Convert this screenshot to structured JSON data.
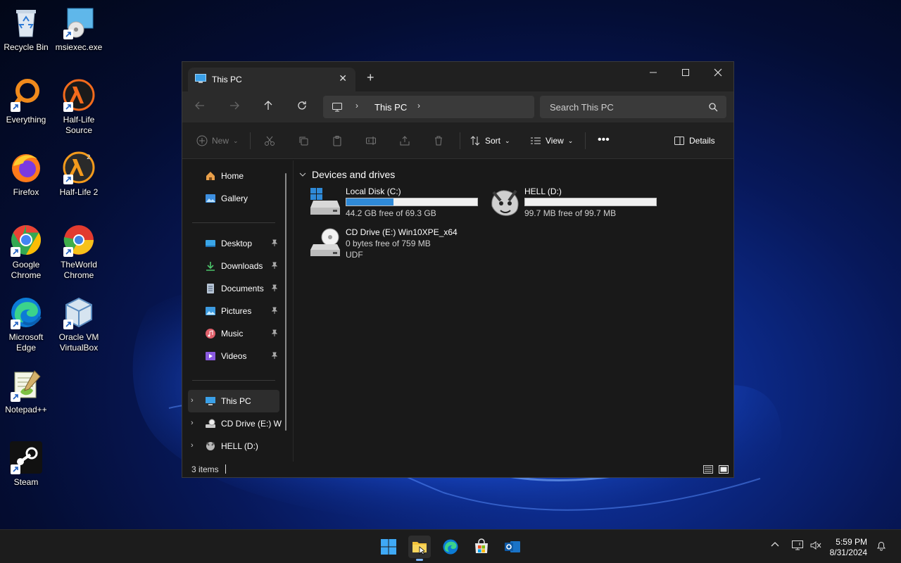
{
  "desktop": {
    "icons": [
      {
        "label": "Recycle Bin",
        "icon": "recycle-bin-icon"
      },
      {
        "label": "msiexec.exe",
        "icon": "installer-icon"
      },
      {
        "label": "Everything",
        "icon": "everything-search-icon"
      },
      {
        "label": "Half-Life Source",
        "icon": "half-life-source-icon"
      },
      {
        "label": "Firefox",
        "icon": "firefox-icon"
      },
      {
        "label": "Half-Life 2",
        "icon": "half-life-2-icon"
      },
      {
        "label": "Google Chrome",
        "icon": "chrome-icon"
      },
      {
        "label": "TheWorld Chrome",
        "icon": "theworld-chrome-icon"
      },
      {
        "label": "Microsoft Edge",
        "icon": "edge-icon"
      },
      {
        "label": "Oracle VM VirtualBox",
        "icon": "virtualbox-icon"
      },
      {
        "label": "Notepad++",
        "icon": "notepad-plus-plus-icon"
      },
      {
        "label": "Steam",
        "icon": "steam-icon"
      }
    ]
  },
  "window": {
    "tab_label": "This PC",
    "address": "This PC",
    "search_placeholder": "Search This PC",
    "toolbar": {
      "new_label": "New",
      "sort_label": "Sort",
      "view_label": "View",
      "details_label": "Details"
    },
    "sidebar": {
      "home": "Home",
      "gallery": "Gallery",
      "quick": [
        {
          "label": "Desktop",
          "icon": "desktop-folder-icon"
        },
        {
          "label": "Downloads",
          "icon": "downloads-icon"
        },
        {
          "label": "Documents",
          "icon": "documents-icon"
        },
        {
          "label": "Pictures",
          "icon": "pictures-icon"
        },
        {
          "label": "Music",
          "icon": "music-icon"
        },
        {
          "label": "Videos",
          "icon": "videos-icon"
        }
      ],
      "tree": [
        {
          "label": "This PC",
          "selected": true
        },
        {
          "label": "CD Drive (E:) Wi"
        },
        {
          "label": "HELL (D:)"
        }
      ]
    },
    "group_title": "Devices and drives",
    "drives": [
      {
        "name": "Local Disk (C:)",
        "info": "44.2 GB free of 69.3 GB",
        "used_fraction": 0.362
      },
      {
        "name": "HELL (D:)",
        "info": "99.7 MB free of 99.7 MB",
        "used_fraction": 0.0
      },
      {
        "name": "CD Drive (E:) Win10XPE_x64",
        "info": "0 bytes free of 759 MB",
        "info2": "UDF"
      }
    ],
    "status_count": "3 items"
  },
  "taskbar": {
    "time": "5:59 PM",
    "date": "8/31/2024"
  },
  "colors": {
    "accent": "#2f8ad8",
    "window_bg": "#191919",
    "taskbar_bg": "#1c1c1c"
  }
}
